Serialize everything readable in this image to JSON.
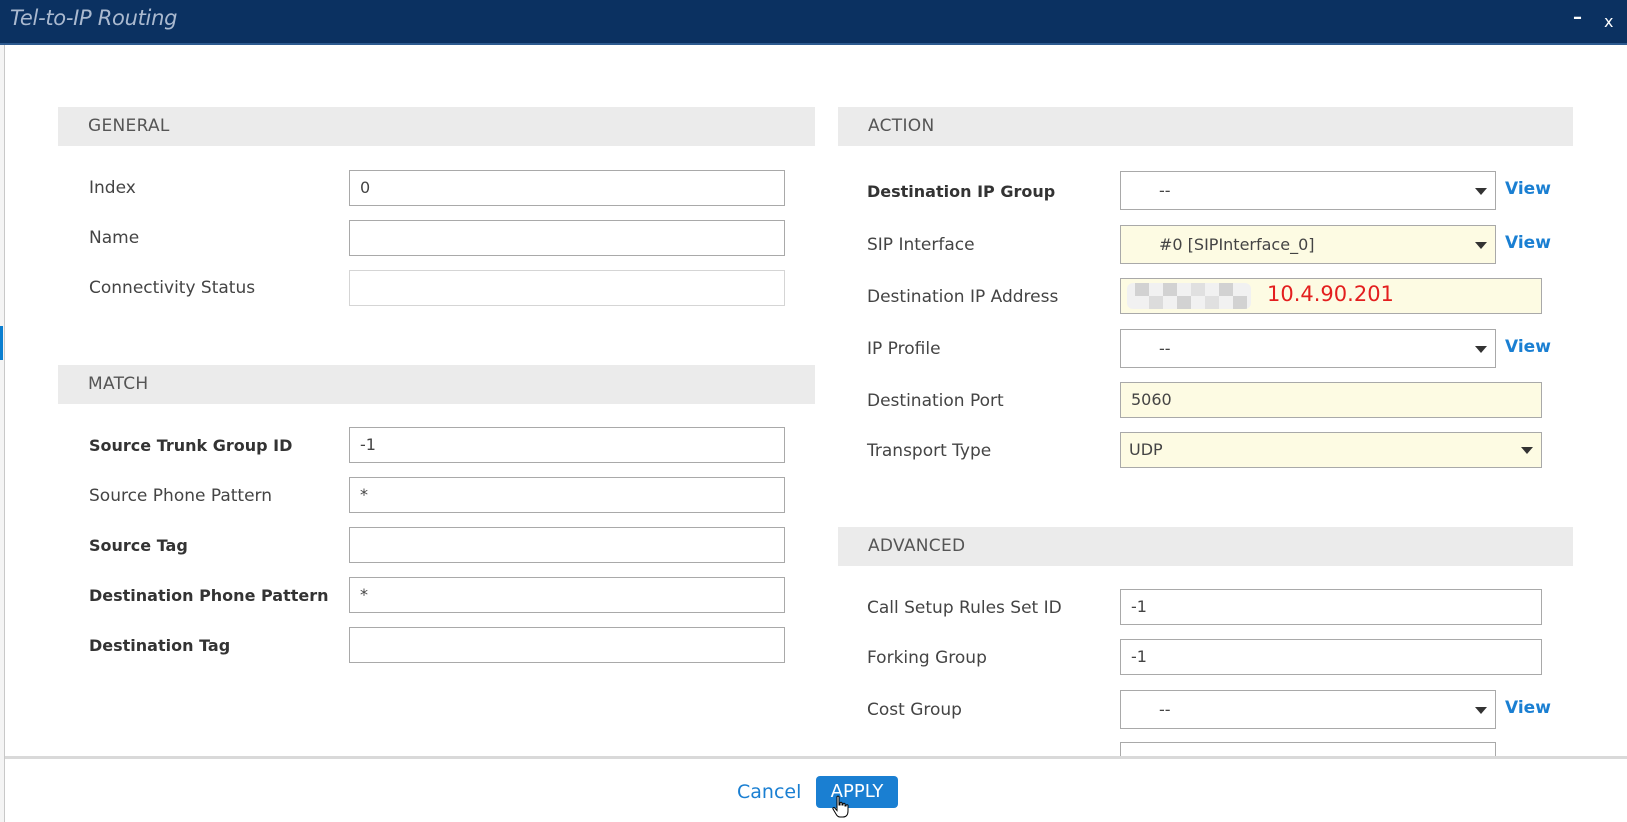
{
  "window": {
    "title": "Tel-to-IP Routing",
    "minimize_label": "–",
    "close_label": "x"
  },
  "general": {
    "header": "GENERAL",
    "index": {
      "label": "Index",
      "value": "0"
    },
    "name": {
      "label": "Name",
      "value": ""
    },
    "connectivity_status": {
      "label": "Connectivity Status",
      "value": ""
    }
  },
  "match": {
    "header": "MATCH",
    "source_trunk_group_id": {
      "label": "Source Trunk Group ID",
      "value": "-1"
    },
    "source_phone_pattern": {
      "label": "Source Phone Pattern",
      "value": "*"
    },
    "source_tag": {
      "label": "Source Tag",
      "value": ""
    },
    "destination_phone_pattern": {
      "label": "Destination Phone Pattern",
      "value": "*"
    },
    "destination_tag": {
      "label": "Destination Tag",
      "value": ""
    }
  },
  "action": {
    "header": "ACTION",
    "destination_ip_group": {
      "label": "Destination IP Group",
      "value": "--",
      "view_label": "View"
    },
    "sip_interface": {
      "label": "SIP Interface",
      "value": "#0 [SIPInterface_0]",
      "view_label": "View"
    },
    "destination_ip_address": {
      "label": "Destination IP Address",
      "value": "10.4.90.201"
    },
    "ip_profile": {
      "label": "IP Profile",
      "value": "--",
      "view_label": "View"
    },
    "destination_port": {
      "label": "Destination Port",
      "value": "5060"
    },
    "transport_type": {
      "label": "Transport Type",
      "value": "UDP"
    }
  },
  "advanced": {
    "header": "ADVANCED",
    "call_setup_rules_set_id": {
      "label": "Call Setup Rules Set ID",
      "value": "-1"
    },
    "forking_group": {
      "label": "Forking Group",
      "value": "-1"
    },
    "cost_group": {
      "label": "Cost Group",
      "value": "--",
      "view_label": "View"
    }
  },
  "footer": {
    "cancel_label": "Cancel",
    "apply_label": "APPLY"
  },
  "colors": {
    "titlebar": "#0b3161",
    "accent": "#1a7fd2",
    "highlight_field": "#fdfbe3",
    "ip_annotation": "#e31e1e"
  }
}
